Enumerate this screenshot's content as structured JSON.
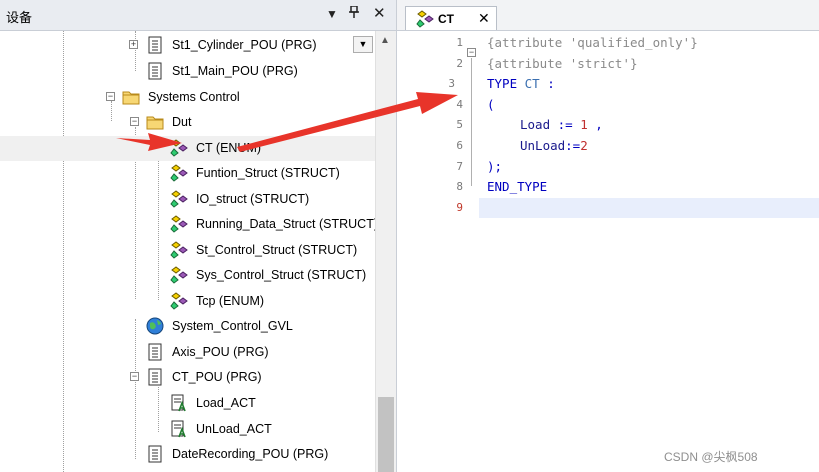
{
  "device_panel": {
    "title": "设备",
    "dropdown_glyph": "▼",
    "pin_glyph": "ᵖ",
    "close_glyph": "✕",
    "tree": [
      {
        "label": "St1_Cylinder_POU (PRG)",
        "icon": "pou-icon"
      },
      {
        "label": "St1_Main_POU (PRG)",
        "icon": "pou-icon"
      },
      {
        "label": "Systems Control",
        "icon": "folder-icon"
      },
      {
        "label": "Dut",
        "icon": "folder-icon"
      },
      {
        "label": "CT (ENUM)",
        "icon": "dut-icon"
      },
      {
        "label": "Funtion_Struct (STRUCT)",
        "icon": "dut-icon"
      },
      {
        "label": "IO_struct (STRUCT)",
        "icon": "dut-icon"
      },
      {
        "label": "Running_Data_Struct (STRUCT)",
        "icon": "dut-icon"
      },
      {
        "label": "St_Control_Struct (STRUCT)",
        "icon": "dut-icon"
      },
      {
        "label": "Sys_Control_Struct (STRUCT)",
        "icon": "dut-icon"
      },
      {
        "label": "Tcp (ENUM)",
        "icon": "dut-icon"
      },
      {
        "label": "System_Control_GVL",
        "icon": "gvl-globe-icon"
      },
      {
        "label": "Axis_POU (PRG)",
        "icon": "pou-icon"
      },
      {
        "label": "CT_POU (PRG)",
        "icon": "pou-icon"
      },
      {
        "label": "Load_ACT",
        "icon": "action-icon"
      },
      {
        "label": "UnLoad_ACT",
        "icon": "action-icon"
      },
      {
        "label": "DateRecording_POU (PRG)",
        "icon": "pou-icon"
      }
    ]
  },
  "editor": {
    "tab_label": "CT",
    "tab_close": "✕",
    "line_numbers": [
      "1",
      "2",
      "3",
      "4",
      "5",
      "6",
      "7",
      "8",
      "9"
    ],
    "code": {
      "l1": "{attribute 'qualified_only'}",
      "l2": "{attribute 'strict'}",
      "l3_kw": "TYPE",
      "l3_name": "CT",
      "l3_colon": " :",
      "l4": "(",
      "l5_id": "Load",
      "l5_op": " := ",
      "l5_num": "1",
      "l5_tail": " ,",
      "l6_id": "UnLoad",
      "l6_op": ":=",
      "l6_num": "2",
      "l7": ");",
      "l8": "END_TYPE"
    }
  },
  "watermark": "CSDN @尖枫508",
  "colors": {
    "annotation_arrow": "#e8342a",
    "keyword": "#0000c0",
    "comment": "#8a8a8a",
    "number": "#c03030"
  }
}
